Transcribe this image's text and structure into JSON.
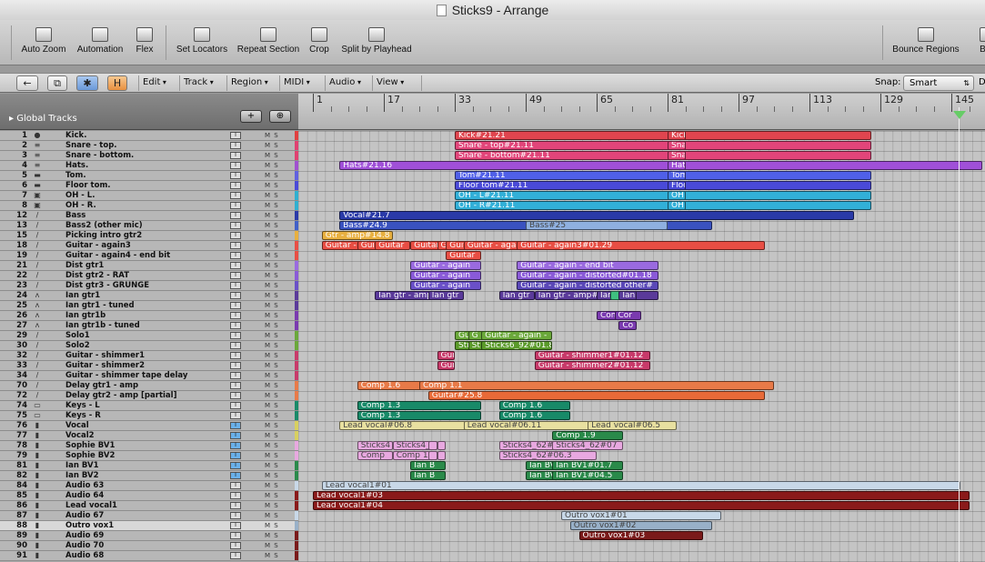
{
  "window": {
    "title": "Sticks9 - Arrange"
  },
  "toolbar": [
    {
      "label": "Auto Zoom",
      "icon": "magnifier-icon"
    },
    {
      "label": "Automation",
      "icon": "automation-icon"
    },
    {
      "label": "Flex",
      "icon": "flex-icon"
    },
    {
      "label": "Set Locators",
      "icon": "set-locators-icon"
    },
    {
      "label": "Repeat Section",
      "icon": "repeat-section-icon"
    },
    {
      "label": "Crop",
      "icon": "crop-icon"
    },
    {
      "label": "Split by Playhead",
      "icon": "split-icon"
    },
    {
      "label": "Bounce Regions",
      "icon": "bounce-icon"
    },
    {
      "label": "Bou",
      "icon": "bounce-icon"
    }
  ],
  "menubar": {
    "buttons": [
      "←",
      "⧉",
      "✱",
      "H"
    ],
    "menus": [
      "Edit",
      "Track",
      "Region",
      "MIDI",
      "Audio",
      "View"
    ],
    "snap_label": "Snap:",
    "snap_value": "Smart",
    "drag_label": "D"
  },
  "global_tracks": "Global Tracks",
  "ruler": {
    "markers": [
      "1",
      "17",
      "33",
      "49",
      "65",
      "81",
      "97",
      "113",
      "129",
      "145"
    ]
  },
  "tracks": [
    {
      "num": "1",
      "name": "Kick."
    },
    {
      "num": "2",
      "name": "Snare - top."
    },
    {
      "num": "3",
      "name": "Snare - bottom."
    },
    {
      "num": "4",
      "name": "Hats."
    },
    {
      "num": "5",
      "name": "Tom."
    },
    {
      "num": "6",
      "name": "Floor tom."
    },
    {
      "num": "7",
      "name": "OH - L."
    },
    {
      "num": "8",
      "name": "OH - R."
    },
    {
      "num": "12",
      "name": "Bass"
    },
    {
      "num": "13",
      "name": "Bass2 (other mic)"
    },
    {
      "num": "15",
      "name": "Picking intro gtr2"
    },
    {
      "num": "18",
      "name": "Guitar - again3"
    },
    {
      "num": "19",
      "name": "Guitar - again4 - end bit"
    },
    {
      "num": "21",
      "name": "Dist gtr1"
    },
    {
      "num": "22",
      "name": "Dist gtr2 - RAT"
    },
    {
      "num": "23",
      "name": "Dist gtr3 - GRUNGE"
    },
    {
      "num": "24",
      "name": "Ian gtr1"
    },
    {
      "num": "25",
      "name": "Ian gtr1 - tuned"
    },
    {
      "num": "26",
      "name": "Ian gtr1b"
    },
    {
      "num": "27",
      "name": "Ian gtr1b - tuned"
    },
    {
      "num": "29",
      "name": "Solo1"
    },
    {
      "num": "30",
      "name": "Solo2"
    },
    {
      "num": "32",
      "name": "Guitar - shimmer1"
    },
    {
      "num": "33",
      "name": "Guitar - shimmer2"
    },
    {
      "num": "34",
      "name": "Guitar - shimmer tape delay"
    },
    {
      "num": "70",
      "name": "Delay gtr1 - amp"
    },
    {
      "num": "72",
      "name": "Delay gtr2 - amp [partial]"
    },
    {
      "num": "74",
      "name": "Keys - L"
    },
    {
      "num": "75",
      "name": "Keys - R"
    },
    {
      "num": "76",
      "name": "Vocal"
    },
    {
      "num": "77",
      "name": "Vocal2"
    },
    {
      "num": "78",
      "name": "Sophie BV1"
    },
    {
      "num": "79",
      "name": "Sophie BV2"
    },
    {
      "num": "81",
      "name": "Ian BV1"
    },
    {
      "num": "82",
      "name": "Ian BV2"
    },
    {
      "num": "84",
      "name": "Audio 63"
    },
    {
      "num": "85",
      "name": "Audio 64"
    },
    {
      "num": "86",
      "name": "Lead vocal1"
    },
    {
      "num": "87",
      "name": "Audio 67"
    },
    {
      "num": "88",
      "name": "Outro vox1"
    },
    {
      "num": "89",
      "name": "Audio 69"
    },
    {
      "num": "90",
      "name": "Audio 70"
    },
    {
      "num": "91",
      "name": "Audio 68"
    }
  ],
  "regions": [
    {
      "row": 0,
      "bar": 33,
      "len": 47,
      "label": "Kick#21.21",
      "color": "#e0454f"
    },
    {
      "row": 1,
      "bar": 33,
      "len": 47,
      "label": "Snare - top#21.11",
      "color": "#e2457a"
    },
    {
      "row": 2,
      "bar": 33,
      "len": 47,
      "label": "Snare - bottom#21.11",
      "color": "#e2457a"
    },
    {
      "row": 3,
      "bar": 7,
      "len": 73,
      "label": "Hats#21.16",
      "color": "#a050d8"
    },
    {
      "row": 4,
      "bar": 33,
      "len": 47,
      "label": "Tom#21.11",
      "color": "#5060e8"
    },
    {
      "row": 5,
      "bar": 33,
      "len": 47,
      "label": "Floor tom#21.11",
      "color": "#4a4ad8"
    },
    {
      "row": 6,
      "bar": 33,
      "len": 47,
      "label": "OH - L#21.11",
      "color": "#32b0d8"
    },
    {
      "row": 7,
      "bar": 33,
      "len": 47,
      "label": "OH - R#21.11",
      "color": "#32b0d8"
    },
    {
      "row": 0,
      "bar": 81,
      "len": 2,
      "label": "Kick",
      "color": "#e0454f"
    },
    {
      "row": 1,
      "bar": 81,
      "len": 2,
      "label": "Sna",
      "color": "#e2457a"
    },
    {
      "row": 2,
      "bar": 81,
      "len": 2,
      "label": "Sna",
      "color": "#e2457a"
    },
    {
      "row": 3,
      "bar": 81,
      "len": 2,
      "label": "Hats",
      "color": "#a050d8"
    },
    {
      "row": 4,
      "bar": 81,
      "len": 2,
      "label": "Tom",
      "color": "#5060e8"
    },
    {
      "row": 5,
      "bar": 81,
      "len": 2,
      "label": "Floo",
      "color": "#4a4ad8"
    },
    {
      "row": 6,
      "bar": 81,
      "len": 2,
      "label": "OH",
      "color": "#32b0d8"
    },
    {
      "row": 7,
      "bar": 81,
      "len": 2,
      "label": "OH",
      "color": "#32b0d8"
    },
    {
      "row": 8,
      "bar": 7,
      "len": 58,
      "label": "Vocal#21.7",
      "color": "#2a3aa8"
    },
    {
      "row": 9,
      "bar": 7,
      "len": 42,
      "label": "Bass#24.9",
      "color": "#3a52c0"
    },
    {
      "row": 9,
      "bar": 49,
      "len": 16,
      "label": "Bass#25",
      "color": "#8fb0e0"
    },
    {
      "row": 10,
      "bar": 3,
      "len": 8,
      "label": "Gtr - amp#14.8",
      "color": "#e8b040"
    },
    {
      "row": 11,
      "bar": 3,
      "len": 8,
      "label": "Guitar - again3",
      "color": "#e84e44"
    },
    {
      "row": 11,
      "bar": 11,
      "len": 4,
      "label": "Guitar -",
      "color": "#e84e44"
    },
    {
      "row": 11,
      "bar": 15,
      "len": 4,
      "label": "Guitar",
      "color": "#e84e44"
    },
    {
      "row": 11,
      "bar": 23,
      "len": 6,
      "label": "Guitar - agi",
      "color": "#e84e44"
    },
    {
      "row": 11,
      "bar": 29,
      "len": 2,
      "label": "Gu",
      "color": "#e84e44"
    },
    {
      "row": 11,
      "bar": 31,
      "len": 4,
      "label": "Guitar -",
      "color": "#e84e44"
    },
    {
      "row": 11,
      "bar": 35,
      "len": 8,
      "label": "Guitar - again3",
      "color": "#e84e44"
    },
    {
      "row": 11,
      "bar": 47,
      "len": 28,
      "label": "Guitar - again3#01.29",
      "color": "#e84e44"
    },
    {
      "row": 12,
      "bar": 31,
      "len": 4,
      "label": "Guitar",
      "color": "#e84e44"
    },
    {
      "row": 13,
      "bar": 23,
      "len": 8,
      "label": "Guitar - again",
      "color": "#9a6ae0"
    },
    {
      "row": 13,
      "bar": 47,
      "len": 16,
      "label": "Guitar - again - end bit",
      "color": "#9a6ae0"
    },
    {
      "row": 14,
      "bar": 23,
      "len": 8,
      "label": "Guitar - again",
      "color": "#8a5ad8"
    },
    {
      "row": 14,
      "bar": 47,
      "len": 16,
      "label": "Guitar - again - distorted#01.18",
      "color": "#8a5ad8"
    },
    {
      "row": 15,
      "bar": 23,
      "len": 8,
      "label": "Guitar - again",
      "color": "#6a50c8"
    },
    {
      "row": 15,
      "bar": 47,
      "len": 16,
      "label": "Guitar - again - distorted other#",
      "color": "#5a48b8"
    },
    {
      "row": 16,
      "bar": 15,
      "len": 8,
      "label": "Ian gtr - amp#0",
      "color": "#5a3a9a"
    },
    {
      "row": 16,
      "bar": 27,
      "len": 4,
      "label": "Ian gtr",
      "color": "#5a3a9a"
    },
    {
      "row": 16,
      "bar": 43,
      "len": 4,
      "label": "Ian gtr",
      "color": "#5a3a9a"
    },
    {
      "row": 16,
      "bar": 51,
      "len": 14,
      "label": "Ian gtr - amp#06.41",
      "color": "#5a3a9a"
    },
    {
      "row": 16,
      "bar": 65,
      "len": 3,
      "label": "Ian",
      "color": "#5a3a9a"
    },
    {
      "row": 16,
      "bar": 68,
      "len": 2,
      "label": "",
      "color": "#40c080"
    },
    {
      "row": 16,
      "bar": 70,
      "len": 2,
      "label": "Ian",
      "color": "#5a3a9a"
    },
    {
      "row": 18,
      "bar": 65,
      "len": 4,
      "label": "Com",
      "color": "#7a3ab0"
    },
    {
      "row": 18,
      "bar": 69,
      "len": 3,
      "label": "Cor",
      "color": "#7a3ab0"
    },
    {
      "row": 19,
      "bar": 70,
      "len": 2,
      "label": "Co",
      "color": "#7a3ab0"
    },
    {
      "row": 20,
      "bar": 33,
      "len": 3,
      "label": "Guita",
      "color": "#6aa83a"
    },
    {
      "row": 20,
      "bar": 36,
      "len": 2,
      "label": "G",
      "color": "#6aa83a"
    },
    {
      "row": 20,
      "bar": 39,
      "len": 8,
      "label": "Guitar - again -",
      "color": "#6aa83a"
    },
    {
      "row": 21,
      "bar": 33,
      "len": 3,
      "label": "Stick",
      "color": "#5a9a2a"
    },
    {
      "row": 21,
      "bar": 36,
      "len": 2,
      "label": "St",
      "color": "#5a9a2a"
    },
    {
      "row": 21,
      "bar": 39,
      "len": 8,
      "label": "Sticks6_92#01.8",
      "color": "#5a9a2a"
    },
    {
      "row": 22,
      "bar": 29,
      "len": 2,
      "label": "Gui",
      "color": "#c83a6a"
    },
    {
      "row": 22,
      "bar": 51,
      "len": 13,
      "label": "Guitar - shimmer1#01.12",
      "color": "#c83a6a"
    },
    {
      "row": 23,
      "bar": 29,
      "len": 2,
      "label": "Gui",
      "color": "#c83a6a"
    },
    {
      "row": 23,
      "bar": 51,
      "len": 13,
      "label": "Guitar - shimmer2#01.12",
      "color": "#c83a6a"
    },
    {
      "row": 25,
      "bar": 11,
      "len": 14,
      "label": "Comp 1.6",
      "color": "#e87a48"
    },
    {
      "row": 25,
      "bar": 25,
      "len": 40,
      "label": "Comp 1.1",
      "color": "#e87a48"
    },
    {
      "row": 26,
      "bar": 27,
      "len": 38,
      "label": "Guitar#25.8",
      "color": "#e86a38"
    },
    {
      "row": 27,
      "bar": 11,
      "len": 14,
      "label": "Comp 1.3",
      "color": "#188a68"
    },
    {
      "row": 27,
      "bar": 43,
      "len": 8,
      "label": "Comp 1.6",
      "color": "#188a68"
    },
    {
      "row": 28,
      "bar": 11,
      "len": 14,
      "label": "Comp 1.3",
      "color": "#188a68"
    },
    {
      "row": 28,
      "bar": 43,
      "len": 8,
      "label": "Comp 1.6",
      "color": "#188a68"
    },
    {
      "row": 29,
      "bar": 7,
      "len": 24,
      "label": "Lead vocal#06.8",
      "color": "#e8e0a0"
    },
    {
      "row": 29,
      "bar": 35,
      "len": 20,
      "label": "Lead vocal#06.11",
      "color": "#e8e0a0"
    },
    {
      "row": 29,
      "bar": 63,
      "len": 10,
      "label": "Lead vocal#06.5",
      "color": "#e8e0a0"
    },
    {
      "row": 30,
      "bar": 55,
      "len": 8,
      "label": "Comp 1.9",
      "color": "#2a8a4a"
    },
    {
      "row": 31,
      "bar": 11,
      "len": 4,
      "label": "Sticks4",
      "color": "#e8a8e0"
    },
    {
      "row": 31,
      "bar": 19,
      "len": 5,
      "label": "Sticks4_6",
      "color": "#e8a8e0"
    },
    {
      "row": 31,
      "bar": 27,
      "len": 1,
      "label": "",
      "color": "#e8a8e0"
    },
    {
      "row": 31,
      "bar": 29,
      "len": 1,
      "label": "",
      "color": "#e8a8e0"
    },
    {
      "row": 31,
      "bar": 43,
      "len": 11,
      "label": "Sticks4_62#08.21",
      "color": "#e8a8e0"
    },
    {
      "row": 31,
      "bar": 55,
      "len": 8,
      "label": "Sticks4_62#07",
      "color": "#e8a8e0"
    },
    {
      "row": 32,
      "bar": 11,
      "len": 4,
      "label": "Comp",
      "color": "#e8a8e0"
    },
    {
      "row": 32,
      "bar": 19,
      "len": 5,
      "label": "Comp 1.2",
      "color": "#e8a8e0"
    },
    {
      "row": 32,
      "bar": 27,
      "len": 1,
      "label": "",
      "color": "#e8a8e0"
    },
    {
      "row": 32,
      "bar": 29,
      "len": 1,
      "label": "",
      "color": "#e8a8e0"
    },
    {
      "row": 32,
      "bar": 43,
      "len": 11,
      "label": "Sticks4_62#06.3",
      "color": "#e8a8e0"
    },
    {
      "row": 33,
      "bar": 23,
      "len": 4,
      "label": "Ian B",
      "color": "#2a8a4a"
    },
    {
      "row": 33,
      "bar": 49,
      "len": 4,
      "label": "Ian BV",
      "color": "#2a8a4a"
    },
    {
      "row": 33,
      "bar": 55,
      "len": 8,
      "label": "Ian BV1#01.7",
      "color": "#2a8a4a"
    },
    {
      "row": 34,
      "bar": 23,
      "len": 4,
      "label": "Ian B",
      "color": "#2a8a4a"
    },
    {
      "row": 34,
      "bar": 49,
      "len": 4,
      "label": "Ian BV",
      "color": "#2a8a4a"
    },
    {
      "row": 34,
      "bar": 55,
      "len": 8,
      "label": "Ian BV1#04.5",
      "color": "#2a8a4a"
    },
    {
      "row": 35,
      "bar": 3,
      "len": 72,
      "label": "Lead vocal1#01",
      "color": "#c8d8e8"
    },
    {
      "row": 36,
      "bar": 1,
      "len": 74,
      "label": "Lead vocal1#03",
      "color": "#8a1a1a"
    },
    {
      "row": 37,
      "bar": 1,
      "len": 74,
      "label": "Lead vocal1#04",
      "color": "#8a1a1a"
    },
    {
      "row": 38,
      "bar": 57,
      "len": 18,
      "label": "Outro vox1#01",
      "color": "#c8d8e8"
    },
    {
      "row": 39,
      "bar": 59,
      "len": 16,
      "label": "Outro vox1#02",
      "color": "#98b0c8"
    },
    {
      "row": 40,
      "bar": 61,
      "len": 14,
      "label": "Outro vox1#03",
      "color": "#7a1a1a"
    }
  ]
}
